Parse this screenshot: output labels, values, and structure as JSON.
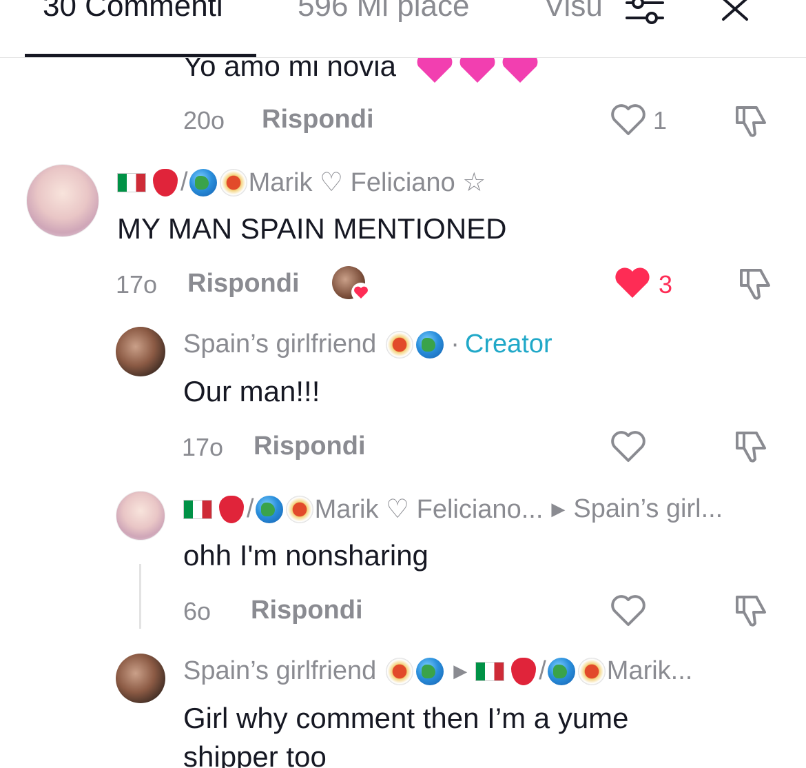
{
  "header": {
    "tab_comments": "30 Commenti",
    "tab_likes": "596 Mi piace",
    "tab_views": "Visu",
    "filter_icon": "sliders-icon",
    "close_icon": "close-icon"
  },
  "comments": [
    {
      "text": "Yo amo mi novia",
      "emoji": "pink-hearts",
      "time": "20o",
      "reply": "Rispondi",
      "likes": "1",
      "liked": false
    },
    {
      "username_prefix": "/",
      "username": "Marik ♡ Feliciano ☆",
      "text": "MY MAN SPAIN MENTIONED",
      "time": "17o",
      "reply": "Rispondi",
      "likes": "3",
      "liked": true,
      "liked_by_creator": true
    }
  ],
  "replies": [
    {
      "username": "Spain’s girlfriend",
      "badge_separator": "·",
      "badge": "Creator",
      "text": "Our man!!!",
      "time": "17o",
      "reply": "Rispondi"
    },
    {
      "username_prefix": "/",
      "username": "Marik ♡ Feliciano...",
      "reply_to": "Spain’s girl...",
      "text": "ohh I'm nonsharing",
      "time": "6o",
      "reply": "Rispondi"
    },
    {
      "username": "Spain’s girlfriend",
      "reply_to_prefix": "/",
      "reply_to": "Marik...",
      "text_line1": "Girl why comment then I’m a yume",
      "text_line2": "shipper too"
    }
  ],
  "colors": {
    "accent_red": "#fe2c55",
    "creator_blue": "#20a8c8",
    "gray_text": "#8a8b91",
    "primary_text": "#161823"
  }
}
